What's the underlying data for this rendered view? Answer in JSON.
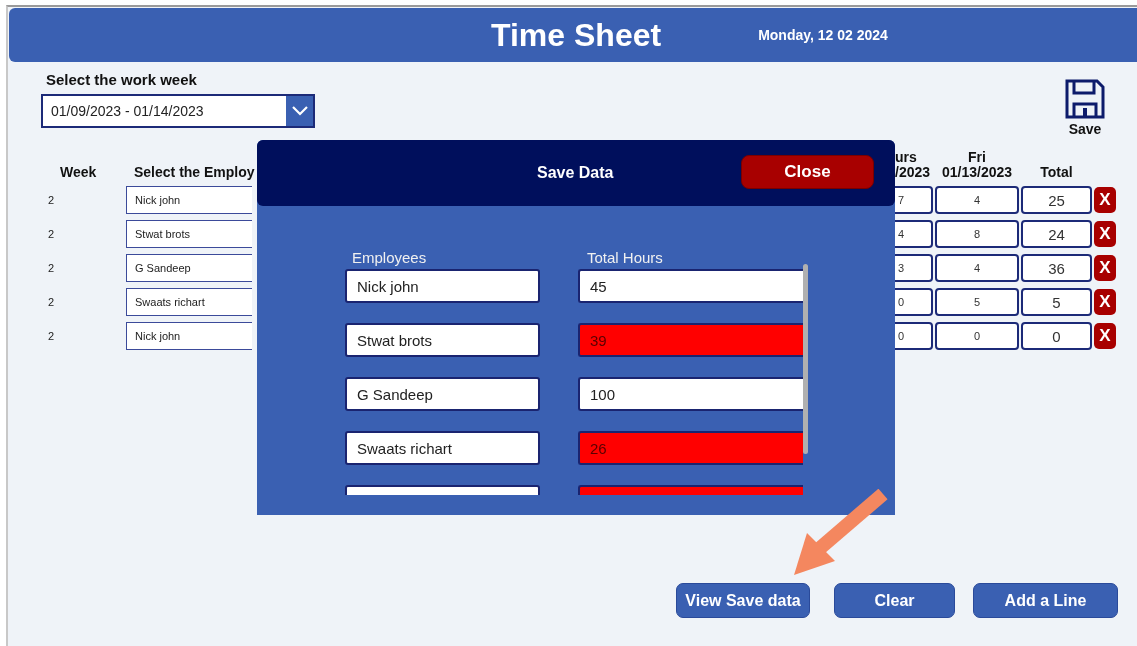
{
  "header": {
    "title": "Time Sheet",
    "date": "Monday, 12 02 2024"
  },
  "week_picker": {
    "label": "Select the work week",
    "value": "01/09/2023 - 01/14/2023"
  },
  "save_button": {
    "label": "Save"
  },
  "table": {
    "columns": [
      {
        "label": "Week"
      },
      {
        "label": "Select the Employ"
      }
    ],
    "right_columns": [
      {
        "label": "urs",
        "sublabel": "/2023"
      },
      {
        "label": "Fri",
        "sublabel": "01/13/2023"
      },
      {
        "label": "Total"
      }
    ],
    "rows": [
      {
        "week": "2",
        "employee": "Nick john",
        "thu": "7",
        "fri": "4",
        "total": "25",
        "delete": "X"
      },
      {
        "week": "2",
        "employee": "Stwat brots",
        "thu": "4",
        "fri": "8",
        "total": "24",
        "delete": "X"
      },
      {
        "week": "2",
        "employee": "G Sandeep",
        "thu": "3",
        "fri": "4",
        "total": "36",
        "delete": "X"
      },
      {
        "week": "2",
        "employee": "Swaats richart",
        "thu": "0",
        "fri": "5",
        "total": "5",
        "delete": "X"
      },
      {
        "week": "2",
        "employee": "Nick john",
        "thu": "0",
        "fri": "0",
        "total": "0",
        "delete": "X"
      }
    ]
  },
  "dialog": {
    "title": "Save Data",
    "close": "Close",
    "columns": [
      "Employees",
      "Total Hours"
    ],
    "rows": [
      {
        "name": "Nick john",
        "hours": "45",
        "flagged": false
      },
      {
        "name": "Stwat brots",
        "hours": "39",
        "flagged": true
      },
      {
        "name": "G Sandeep",
        "hours": "100",
        "flagged": false
      },
      {
        "name": "Swaats richart",
        "hours": "26",
        "flagged": true
      },
      {
        "flagged": true
      }
    ]
  },
  "buttons": [
    "View Save data",
    "Clear",
    "Add a Line"
  ]
}
